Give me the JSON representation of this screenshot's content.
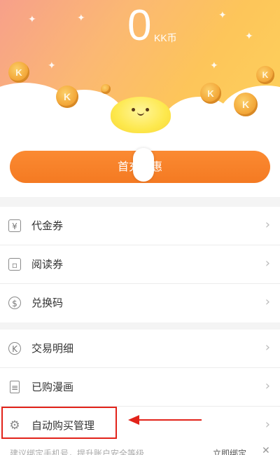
{
  "wallet": {
    "balance": "0",
    "unit": "KK币"
  },
  "coin_symbol": "K",
  "promo": {
    "label": "首充优惠"
  },
  "sections": [
    {
      "items": [
        {
          "label": "代金券",
          "icon": "voucher-icon"
        },
        {
          "label": "阅读券",
          "icon": "ticket-icon"
        },
        {
          "label": "兑换码",
          "icon": "dollar-circle-icon"
        }
      ]
    },
    {
      "items": [
        {
          "label": "交易明细",
          "icon": "k-circle-icon"
        },
        {
          "label": "已购漫画",
          "icon": "document-icon"
        },
        {
          "label": "自动购买管理",
          "icon": "gear-icon"
        }
      ]
    }
  ],
  "bottom": {
    "tip": "建议绑定手机号，提升账户安全等级",
    "link": "立即绑定",
    "close": "✕"
  },
  "colors": {
    "accent": "#f47a22",
    "annotation": "#e2231a"
  }
}
